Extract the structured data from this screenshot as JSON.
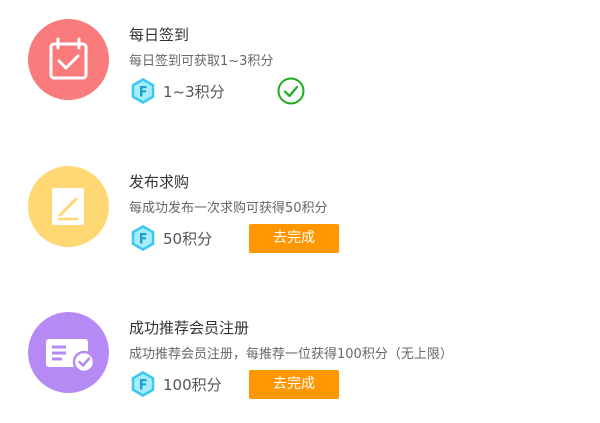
{
  "tasks": [
    {
      "title": "每日签到",
      "desc": "每日签到可获取1~3积分",
      "reward": "1~3积分",
      "status": "completed",
      "icon": "calendar-check-icon",
      "color": "#f97b7b"
    },
    {
      "title": "发布求购",
      "desc": "每成功发布一次求购可获得50积分",
      "reward": "50积分",
      "button_label": "去完成",
      "icon": "edit-icon",
      "color": "#ffd873"
    },
    {
      "title": "成功推荐会员注册",
      "desc": "成功推荐会员注册，每推荐一位获得100积分（无上限）",
      "reward": "100积分",
      "button_label": "去完成",
      "icon": "member-card-icon",
      "color": "#b68af5"
    }
  ],
  "colors": {
    "accent_button": "#ff9800",
    "completed_check": "#1aad19",
    "coin": "#3cc8f0"
  }
}
